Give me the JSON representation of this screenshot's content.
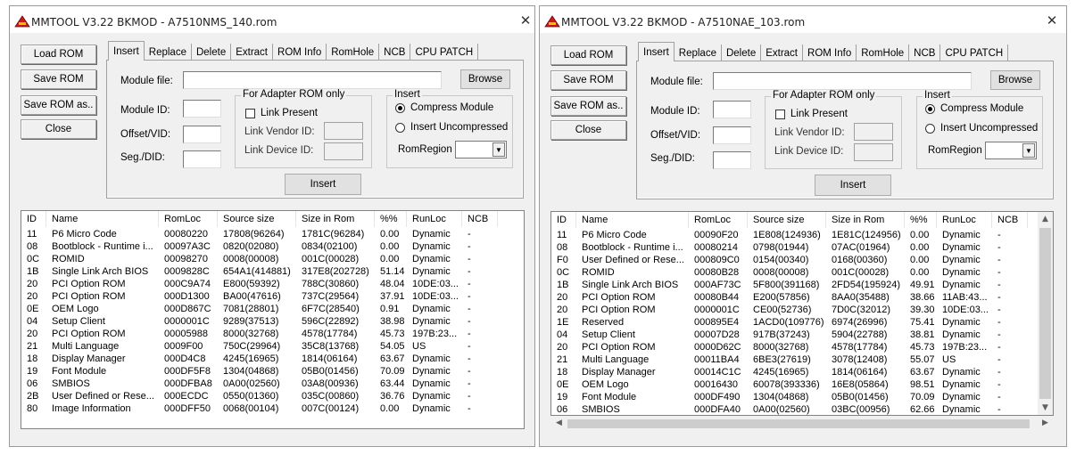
{
  "left": {
    "title": "MMTOOL V3.22 BKMOD - A7510NMS_140.rom",
    "side_buttons": [
      "Load ROM",
      "Save ROM",
      "Save ROM as..",
      "Close"
    ],
    "tabs": [
      "Insert",
      "Replace",
      "Delete",
      "Extract",
      "ROM Info",
      "RomHole",
      "NCB",
      "CPU PATCH"
    ],
    "insert": {
      "module_file_label": "Module file:",
      "browse_label": "Browse",
      "module_id_label": "Module ID:",
      "offset_label": "Offset/VID:",
      "seg_label": "Seg./DID:",
      "adapter_group": "For Adapter ROM only",
      "link_present": "Link Present",
      "link_vendor": "Link Vendor ID:",
      "link_device": "Link Device ID:",
      "insert_group": "Insert",
      "compress": "Compress Module",
      "uncompressed": "Insert Uncompressed",
      "romregion": "RomRegion",
      "insert_button": "Insert"
    },
    "columns": [
      "ID",
      "Name",
      "RomLoc",
      "Source size",
      "Size in Rom",
      "%%",
      "RunLoc",
      "NCB"
    ],
    "rows": [
      [
        "11",
        "P6 Micro Code",
        "00080220",
        "17808(96264)",
        "1781C(96284)",
        "0.00",
        "Dynamic",
        "-"
      ],
      [
        "08",
        "Bootblock - Runtime i...",
        "00097A3C",
        "0820(02080)",
        "0834(02100)",
        "0.00",
        "Dynamic",
        "-"
      ],
      [
        "0C",
        "ROMID",
        "00098270",
        "0008(00008)",
        "001C(00028)",
        "0.00",
        "Dynamic",
        "-"
      ],
      [
        "1B",
        "Single Link Arch BIOS",
        "0009828C",
        "654A1(414881)",
        "317E8(202728)",
        "51.14",
        "Dynamic",
        "-"
      ],
      [
        "20",
        "PCI Option ROM",
        "000C9A74",
        "E800(59392)",
        "788C(30860)",
        "48.04",
        "10DE:03...",
        "-"
      ],
      [
        "20",
        "PCI Option ROM",
        "000D1300",
        "BA00(47616)",
        "737C(29564)",
        "37.91",
        "10DE:03...",
        "-"
      ],
      [
        "0E",
        "OEM Logo",
        "000D867C",
        "7081(28801)",
        "6F7C(28540)",
        "0.91",
        "Dynamic",
        "-"
      ],
      [
        "04",
        "Setup Client",
        "0000001C",
        "9289(37513)",
        "596C(22892)",
        "38.98",
        "Dynamic",
        "-"
      ],
      [
        "20",
        "PCI Option ROM",
        "00005988",
        "8000(32768)",
        "4578(17784)",
        "45.73",
        "197B:23...",
        "-"
      ],
      [
        "21",
        "Multi Language",
        "0009F00",
        "750C(29964)",
        "35C8(13768)",
        "54.05",
        "US",
        "-"
      ],
      [
        "18",
        "Display Manager",
        "000D4C8",
        "4245(16965)",
        "1814(06164)",
        "63.67",
        "Dynamic",
        "-"
      ],
      [
        "19",
        "Font Module",
        "000DF5F8",
        "1304(04868)",
        "05B0(01456)",
        "70.09",
        "Dynamic",
        "-"
      ],
      [
        "06",
        "SMBIOS",
        "000DFBA8",
        "0A00(02560)",
        "03A8(00936)",
        "63.44",
        "Dynamic",
        "-"
      ],
      [
        "2B",
        "User Defined or Rese...",
        "000ECDC",
        "0550(01360)",
        "035C(00860)",
        "36.76",
        "Dynamic",
        "-"
      ],
      [
        "80",
        "Image Information",
        "000DFF50",
        "0068(00104)",
        "007C(00124)",
        "0.00",
        "Dynamic",
        "-"
      ]
    ]
  },
  "right": {
    "title": "MMTOOL V3.22 BKMOD - A7510NAE_103.rom",
    "side_buttons": [
      "Load ROM",
      "Save ROM",
      "Save ROM as..",
      "Close"
    ],
    "tabs": [
      "Insert",
      "Replace",
      "Delete",
      "Extract",
      "ROM Info",
      "RomHole",
      "NCB",
      "CPU PATCH"
    ],
    "insert": {
      "module_file_label": "Module file:",
      "browse_label": "Browse",
      "module_id_label": "Module ID:",
      "offset_label": "Offset/VID:",
      "seg_label": "Seg./DID:",
      "adapter_group": "For Adapter ROM only",
      "link_present": "Link Present",
      "link_vendor": "Link Vendor ID:",
      "link_device": "Link Device ID:",
      "insert_group": "Insert",
      "compress": "Compress Module",
      "uncompressed": "Insert Uncompressed",
      "romregion": "RomRegion",
      "insert_button": "Insert"
    },
    "columns": [
      "ID",
      "Name",
      "RomLoc",
      "Source size",
      "Size in Rom",
      "%%",
      "RunLoc",
      "NCB"
    ],
    "rows": [
      [
        "11",
        "P6 Micro Code",
        "00090F20",
        "1E808(124936)",
        "1E81C(124956)",
        "0.00",
        "Dynamic",
        "-"
      ],
      [
        "08",
        "Bootblock - Runtime i...",
        "00080214",
        "0798(01944)",
        "07AC(01964)",
        "0.00",
        "Dynamic",
        "-"
      ],
      [
        "F0",
        "User Defined or Rese...",
        "000809C0",
        "0154(00340)",
        "0168(00360)",
        "0.00",
        "Dynamic",
        "-"
      ],
      [
        "0C",
        "ROMID",
        "00080B28",
        "0008(00008)",
        "001C(00028)",
        "0.00",
        "Dynamic",
        "-"
      ],
      [
        "1B",
        "Single Link Arch BIOS",
        "000AF73C",
        "5F800(391168)",
        "2FD54(195924)",
        "49.91",
        "Dynamic",
        "-"
      ],
      [
        "20",
        "PCI Option ROM",
        "00080B44",
        "E200(57856)",
        "8AA0(35488)",
        "38.66",
        "11AB:43...",
        "-"
      ],
      [
        "20",
        "PCI Option ROM",
        "0000001C",
        "CE00(52736)",
        "7D0C(32012)",
        "39.30",
        "10DE:03...",
        "-"
      ],
      [
        "1E",
        "Reserved",
        "000895E4",
        "1ACD0(109776)",
        "6974(26996)",
        "75.41",
        "Dynamic",
        "-"
      ],
      [
        "04",
        "Setup Client",
        "00007D28",
        "917B(37243)",
        "5904(22788)",
        "38.81",
        "Dynamic",
        "-"
      ],
      [
        "20",
        "PCI Option ROM",
        "0000D62C",
        "8000(32768)",
        "4578(17784)",
        "45.73",
        "197B:23...",
        "-"
      ],
      [
        "21",
        "Multi Language",
        "00011BA4",
        "6BE3(27619)",
        "3078(12408)",
        "55.07",
        "US",
        "-"
      ],
      [
        "18",
        "Display Manager",
        "00014C1C",
        "4245(16965)",
        "1814(06164)",
        "63.67",
        "Dynamic",
        "-"
      ],
      [
        "0E",
        "OEM Logo",
        "00016430",
        "60078(393336)",
        "16E8(05864)",
        "98.51",
        "Dynamic",
        "-"
      ],
      [
        "19",
        "Font Module",
        "000DF490",
        "1304(04868)",
        "05B0(01456)",
        "70.09",
        "Dynamic",
        "-"
      ],
      [
        "06",
        "SMBIOS",
        "000DFA40",
        "0A00(02560)",
        "03BC(00956)",
        "62.66",
        "Dynamic",
        "-"
      ]
    ]
  }
}
